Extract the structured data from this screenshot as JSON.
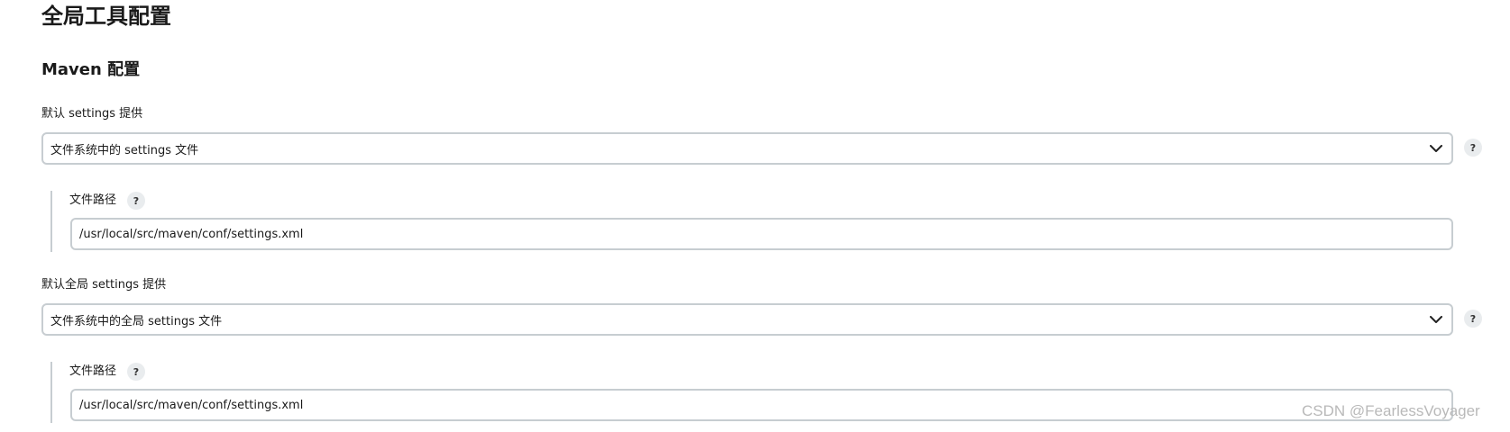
{
  "page": {
    "title": "全局工具配置"
  },
  "maven": {
    "section_title": "Maven 配置",
    "default_settings": {
      "label": "默认 settings 提供",
      "selected": "文件系统中的 settings 文件",
      "help": "?",
      "file_path": {
        "label": "文件路径",
        "help": "?",
        "value": "/usr/local/src/maven/conf/settings.xml"
      }
    },
    "global_settings": {
      "label": "默认全局 settings 提供",
      "selected": "文件系统中的全局 settings 文件",
      "help": "?",
      "file_path": {
        "label": "文件路径",
        "help": "?",
        "value": "/usr/local/src/maven/conf/settings.xml"
      }
    }
  },
  "watermark": "CSDN @FearlessVoyager",
  "icons": {
    "dropdown": "chevron-down-icon",
    "help": "help-icon"
  }
}
